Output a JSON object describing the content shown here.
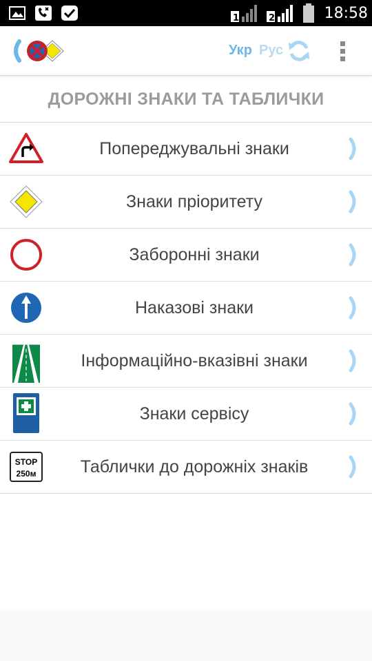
{
  "status_bar": {
    "time": "18:58",
    "sim1_label": "1",
    "sim2_label": "2",
    "icons": [
      "gallery-icon",
      "missed-call-icon",
      "task-done-icon",
      "signal-sim1-icon",
      "signal-sim2-icon",
      "battery-icon"
    ]
  },
  "app_bar": {
    "lang_ukr": "Укр",
    "lang_rus": "Рус",
    "icons": [
      "back-chevron-icon",
      "app-logo-icon",
      "refresh-icon",
      "overflow-menu-icon"
    ]
  },
  "section_title": "ДОРОЖНІ ЗНАКИ ТА ТАБЛИЧКИ",
  "categories": [
    {
      "label": "Попереджувальні знаки",
      "icon": "warning-sign-icon"
    },
    {
      "label": "Знаки пріоритету",
      "icon": "priority-sign-icon"
    },
    {
      "label": "Заборонні знаки",
      "icon": "prohibitory-sign-icon"
    },
    {
      "label": "Наказові знаки",
      "icon": "mandatory-sign-icon"
    },
    {
      "label": "Інформаційно-вказівні знаки",
      "icon": "information-sign-icon"
    },
    {
      "label": "Знаки сервісу",
      "icon": "service-sign-icon"
    },
    {
      "label": "Таблички до дорожніх знаків",
      "icon": "plate-sign-icon"
    }
  ],
  "plate_text": {
    "line1": "STOP",
    "line2": "250м"
  },
  "colors": {
    "accent": "#6cb6e8",
    "accent_light": "#b9dbf2",
    "chevron": "#a9d6f5",
    "title_grey": "#9b9b9b",
    "text": "#444444",
    "warning_red": "#d0212b",
    "priority_yellow": "#f5e600",
    "mandatory_blue": "#1f67b3",
    "info_green": "#0d8a4a",
    "service_blue": "#1f5fa6"
  }
}
